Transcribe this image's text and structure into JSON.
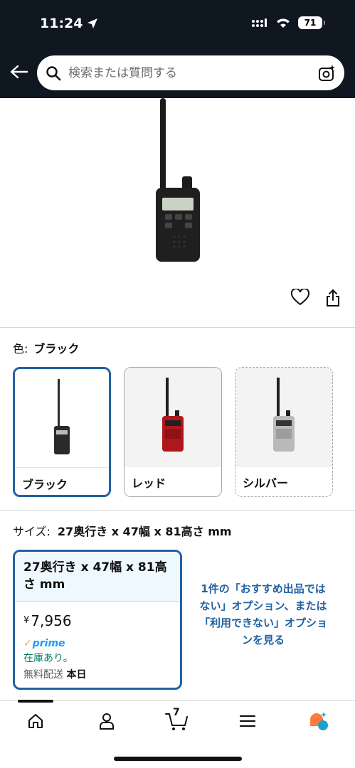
{
  "status": {
    "time": "11:24",
    "battery": "71"
  },
  "search": {
    "placeholder": "検索または質問する"
  },
  "variation": {
    "color_label": "色:",
    "color_value": "ブラック",
    "swatches": [
      {
        "label": "ブラック",
        "color": "#2a2a2a"
      },
      {
        "label": "レッド",
        "color": "#b0171d"
      },
      {
        "label": "シルバー",
        "color": "#b9b9b9"
      }
    ]
  },
  "size": {
    "label": "サイズ:",
    "value": "27奥行き x 47幅 x 81高さ mm",
    "card": {
      "title": "27奥行き x 47幅 x 81高さ mm",
      "currency": "¥",
      "price": "7,956",
      "prime_check": "✓",
      "prime": "prime",
      "stock": "在庫あり。",
      "shipping_label": "無料配送",
      "shipping_day": "本日"
    },
    "other_options_text": "1件の「おすすめ出品ではない」オプション、または「利用できない」オプションを見る"
  },
  "nav": {
    "cart_count": "7"
  },
  "colors": {
    "header_bg": "#0f1721",
    "accent": "#2162a1",
    "prime": "#1a98ff",
    "stock": "#067d62"
  }
}
